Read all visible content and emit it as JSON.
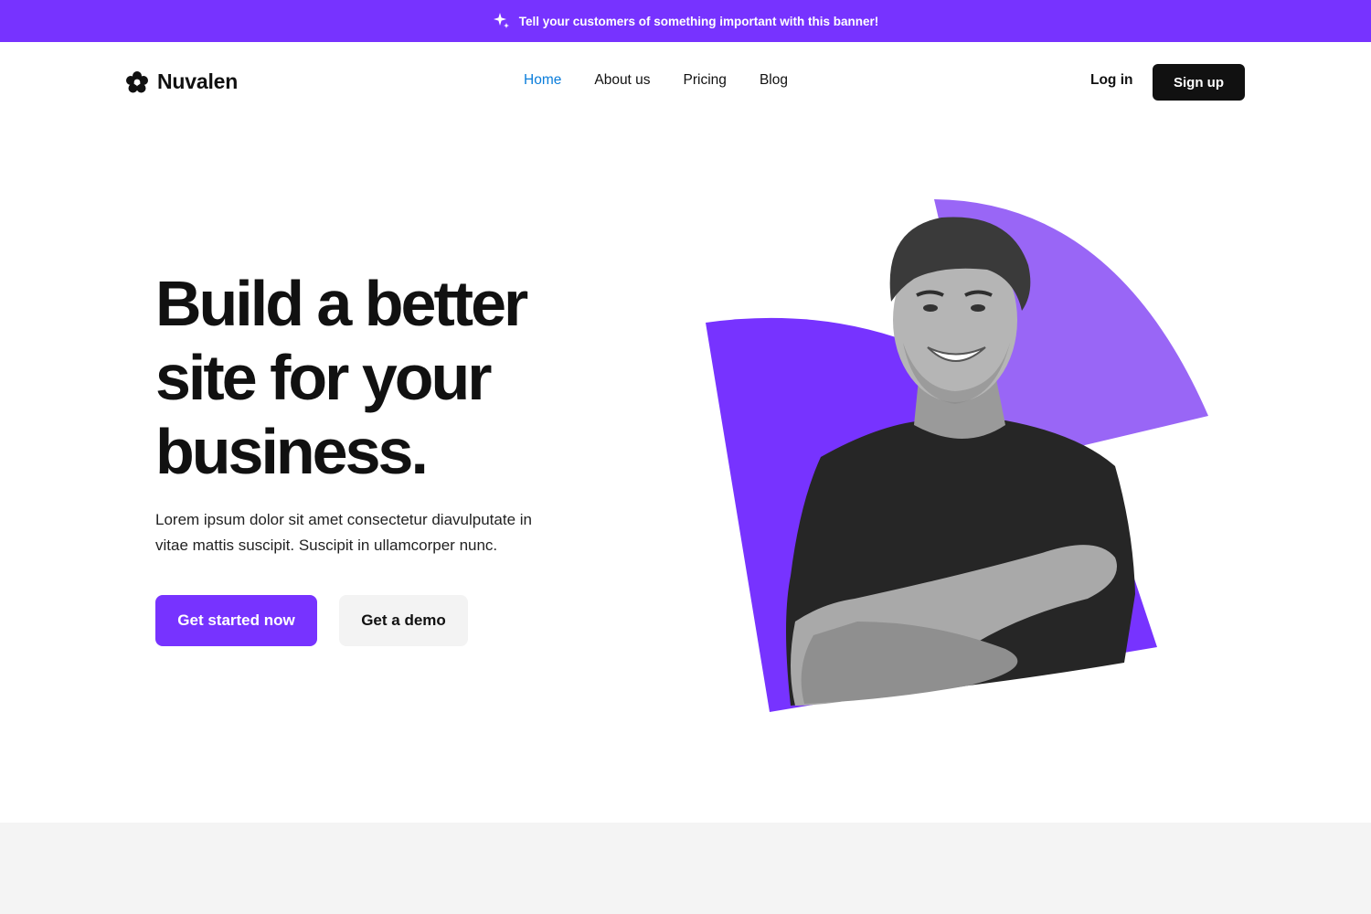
{
  "banner": {
    "icon": "sparkle-icon",
    "text": "Tell your customers of something important with this banner!",
    "background": "#7733ff"
  },
  "nav": {
    "logo_icon": "flower-logo-icon",
    "brand": "Nuvalen",
    "links": [
      {
        "label": "Home",
        "active": true
      },
      {
        "label": "About us",
        "active": false
      },
      {
        "label": "Pricing",
        "active": false
      },
      {
        "label": "Blog",
        "active": false
      }
    ],
    "login_label": "Log in",
    "signup_label": "Sign up"
  },
  "hero": {
    "title_lines": [
      "Build a better",
      "site for your",
      "business."
    ],
    "description": "Lorem ipsum dolor sit amet consectetur diavulputate in vitae mattis suscipit. Suscipit in ullamcorper nunc.",
    "primary_cta": "Get started now",
    "secondary_cta": "Get a demo",
    "image": "smiling-man-arms-crossed-photo"
  },
  "colors": {
    "accent": "#7733ff",
    "accent_light": "#9966f6",
    "active_link": "#0a7ddb",
    "dark": "#111111",
    "footer_band": "#f4f4f4"
  }
}
